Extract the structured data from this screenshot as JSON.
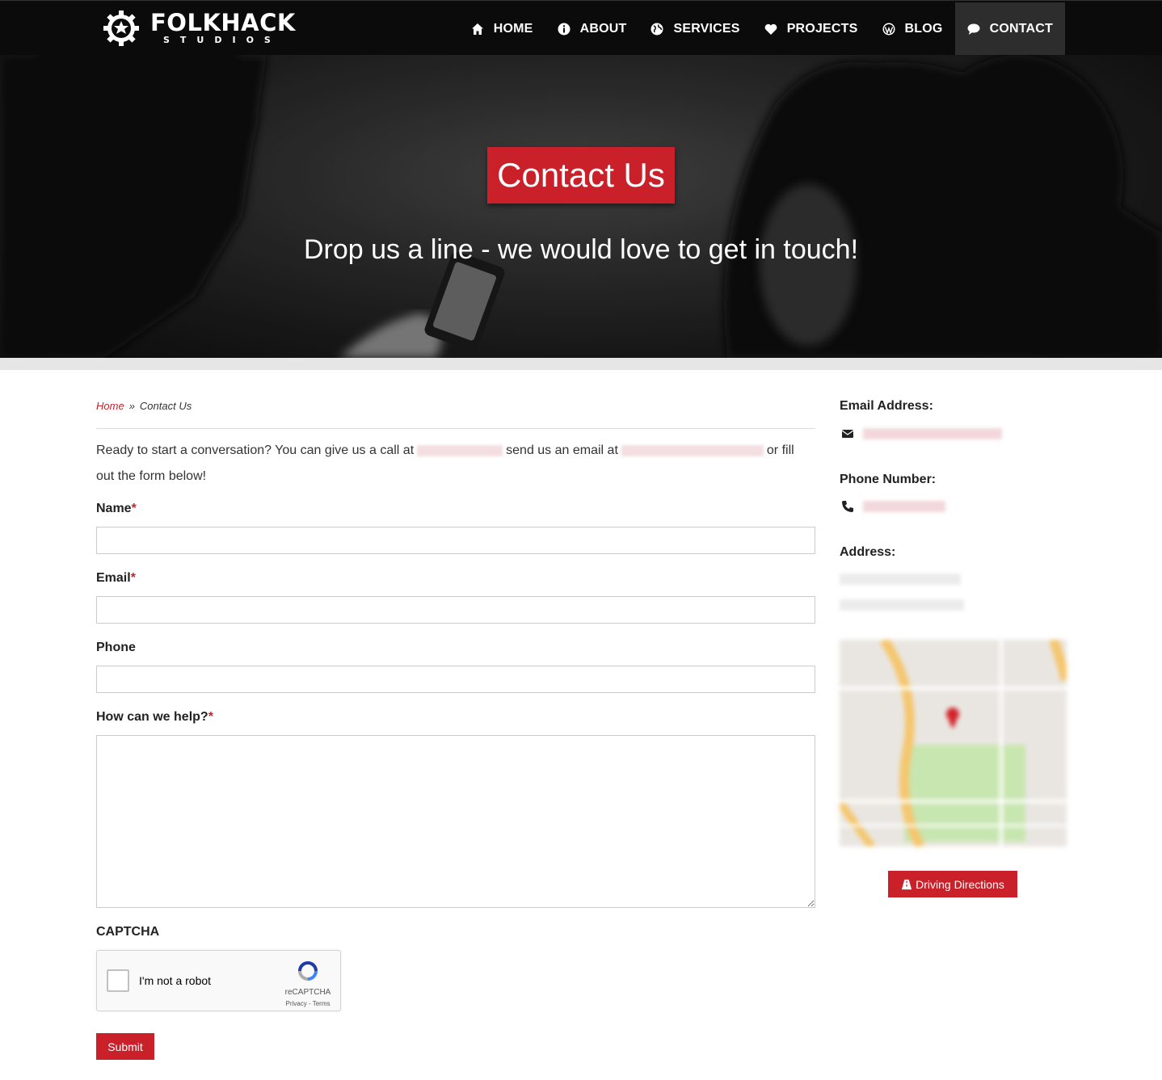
{
  "nav": {
    "logo_main": "FOLKHACK",
    "logo_sub": "STUDIOS",
    "items": [
      {
        "label": "HOME",
        "icon": "home-icon"
      },
      {
        "label": "ABOUT",
        "icon": "info-icon"
      },
      {
        "label": "SERVICES",
        "icon": "globe-icon"
      },
      {
        "label": "PROJECTS",
        "icon": "heart-icon"
      },
      {
        "label": "BLOG",
        "icon": "wordpress-icon"
      },
      {
        "label": "CONTACT",
        "icon": "comment-icon",
        "active": true
      }
    ]
  },
  "hero": {
    "title": "Contact Us",
    "subtitle": "Drop us a line - we would love to get in touch!"
  },
  "breadcrumb": {
    "home": "Home",
    "separator": "»",
    "current": "Contact Us"
  },
  "intro": {
    "part1": "Ready to start a conversation? You can give us a call at",
    "part2": "send us an email at",
    "part3": "or fill out the form below!"
  },
  "form": {
    "name_label": "Name",
    "email_label": "Email",
    "phone_label": "Phone",
    "help_label": "How can we help?",
    "required_mark": "*",
    "captcha_label": "CAPTCHA",
    "captcha_text": "I'm not a robot",
    "captcha_brand": "reCAPTCHA",
    "captcha_terms": "Privacy - Terms",
    "submit_label": "Submit"
  },
  "sidebar": {
    "email_heading": "Email Address:",
    "phone_heading": "Phone Number:",
    "address_heading": "Address:",
    "directions_label": "Driving Directions"
  },
  "colors": {
    "accent": "#c9202a",
    "nav_bg": "#0b0b0b",
    "nav_active": "#2d2d2d"
  }
}
